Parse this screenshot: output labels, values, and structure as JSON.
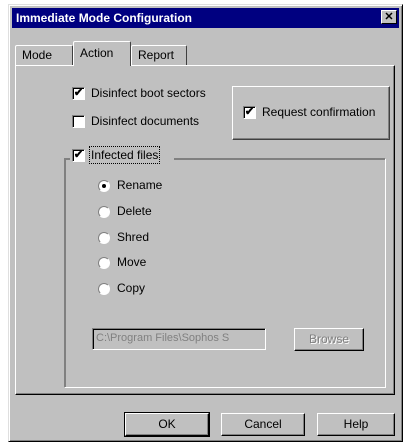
{
  "window": {
    "title": "Immediate Mode Configuration",
    "close_glyph": "✕"
  },
  "tabs": [
    {
      "label": "Mode",
      "active": false
    },
    {
      "label": "Action",
      "active": true
    },
    {
      "label": "Report",
      "active": false
    }
  ],
  "options": {
    "disinfect_boot": {
      "label": "Disinfect boot sectors",
      "checked": true
    },
    "disinfect_docs": {
      "label": "Disinfect documents",
      "checked": false
    },
    "request_confirmation": {
      "label": "Request confirmation",
      "checked": true
    },
    "infected_files": {
      "label": "Infected files",
      "checked": true
    }
  },
  "infected_actions": [
    {
      "label": "Rename",
      "selected": true
    },
    {
      "label": "Delete",
      "selected": false
    },
    {
      "label": "Shred",
      "selected": false
    },
    {
      "label": "Move",
      "selected": false
    },
    {
      "label": "Copy",
      "selected": false
    }
  ],
  "path_field": {
    "value": "C:\\Program Files\\Sophos S"
  },
  "browse_button": {
    "label": "Browse"
  },
  "footer": {
    "ok_label": "OK",
    "cancel_label": "Cancel",
    "help_label": "Help"
  },
  "icons": {
    "check": "✔",
    "close": "close-icon"
  }
}
